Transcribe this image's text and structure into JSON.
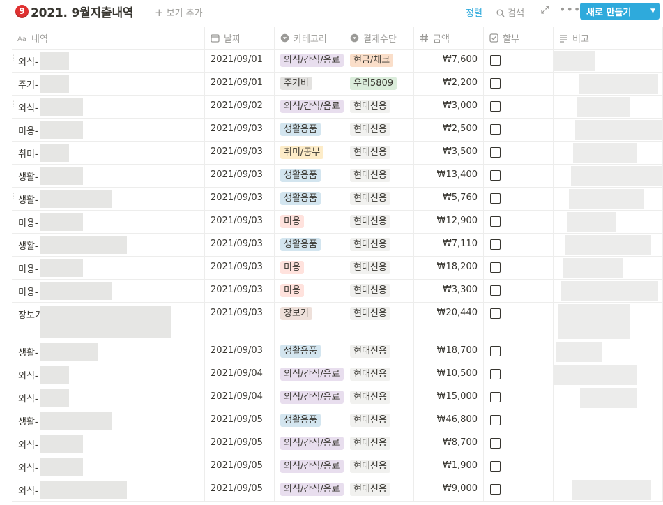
{
  "header": {
    "badge": "9",
    "title": "2021. 9월지출내역",
    "add_view": "보기 추가",
    "sort": "정렬",
    "search": "검색",
    "new_button": "새로 만들기"
  },
  "columns": {
    "name": "내역",
    "date": "날짜",
    "category": "카테고리",
    "payment": "결제수단",
    "amount": "금액",
    "installment": "할부",
    "note": "비고"
  },
  "tag_colors": {
    "외식/간식/음료": "#e8deee",
    "주거비": "#e3e2e0",
    "생활용품": "#d3e5ef",
    "취미/공부": "#fdecc8",
    "미용": "#ffe2dd",
    "장보기": "#eee0da",
    "현금/체크": "#fadec9",
    "우리5809": "#dbeddb",
    "현대신용": "#f1f1ef"
  },
  "rows": [
    {
      "name": "외식-",
      "date": "2021/09/01",
      "category": "외식/간식/음료",
      "payment": "현금/체크",
      "amount": "₩7,600",
      "installment": false
    },
    {
      "name": "주거-",
      "date": "2021/09/01",
      "category": "주거비",
      "payment": "우리5809",
      "amount": "₩2,200",
      "installment": false
    },
    {
      "name": "외식-",
      "date": "2021/09/02",
      "category": "외식/간식/음료",
      "payment": "현대신용",
      "amount": "₩3,000",
      "installment": false
    },
    {
      "name": "미용-",
      "date": "2021/09/03",
      "category": "생활용품",
      "payment": "현대신용",
      "amount": "₩2,500",
      "installment": false
    },
    {
      "name": "취미-",
      "date": "2021/09/03",
      "category": "취미/공부",
      "payment": "현대신용",
      "amount": "₩3,500",
      "installment": false
    },
    {
      "name": "생활-",
      "date": "2021/09/03",
      "category": "생활용품",
      "payment": "현대신용",
      "amount": "₩13,400",
      "installment": false
    },
    {
      "name": "생활-",
      "date": "2021/09/03",
      "category": "생활용품",
      "payment": "현대신용",
      "amount": "₩5,760",
      "installment": false
    },
    {
      "name": "미용-",
      "date": "2021/09/03",
      "category": "미용",
      "payment": "현대신용",
      "amount": "₩12,900",
      "installment": false
    },
    {
      "name": "생활-",
      "date": "2021/09/03",
      "category": "생활용품",
      "payment": "현대신용",
      "amount": "₩7,110",
      "installment": false
    },
    {
      "name": "미용-",
      "date": "2021/09/03",
      "category": "미용",
      "payment": "현대신용",
      "amount": "₩18,200",
      "installment": false
    },
    {
      "name": "미용-",
      "date": "2021/09/03",
      "category": "미용",
      "payment": "현대신용",
      "amount": "₩3,300",
      "installment": false
    },
    {
      "name": "장보기",
      "date": "2021/09/03",
      "category": "장보기",
      "payment": "현대신용",
      "amount": "₩20,440",
      "installment": false
    },
    {
      "name": "생활-",
      "date": "2021/09/03",
      "category": "생활용품",
      "payment": "현대신용",
      "amount": "₩18,700",
      "installment": false
    },
    {
      "name": "외식-",
      "date": "2021/09/04",
      "category": "외식/간식/음료",
      "payment": "현대신용",
      "amount": "₩10,500",
      "installment": false
    },
    {
      "name": "외식-",
      "date": "2021/09/04",
      "category": "외식/간식/음료",
      "payment": "현대신용",
      "amount": "₩15,000",
      "installment": false
    },
    {
      "name": "생활-",
      "date": "2021/09/05",
      "category": "생활용품",
      "payment": "현대신용",
      "amount": "₩46,800",
      "installment": false
    },
    {
      "name": "외식-",
      "date": "2021/09/05",
      "category": "외식/간식/음료",
      "payment": "현대신용",
      "amount": "₩8,700",
      "installment": false
    },
    {
      "name": "외식-",
      "date": "2021/09/05",
      "category": "외식/간식/음료",
      "payment": "현대신용",
      "amount": "₩1,900",
      "installment": false
    },
    {
      "name": "외식-",
      "date": "2021/09/05",
      "category": "외식/간식/음료",
      "payment": "현대신용",
      "amount": "₩9,000",
      "installment": false
    }
  ]
}
